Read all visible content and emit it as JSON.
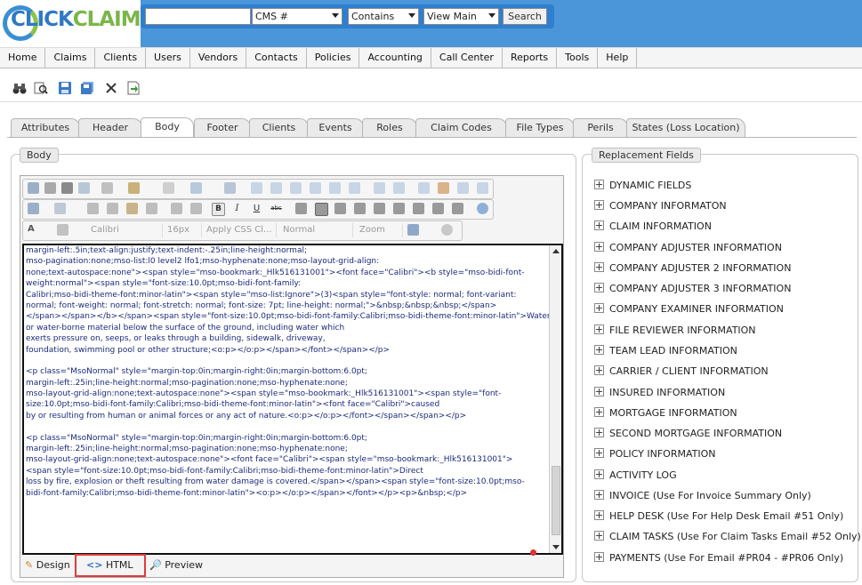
{
  "logo": {
    "left": "CLICK",
    "right": "CLAIMS"
  },
  "search": {
    "query_value": "",
    "field_select": "CMS #",
    "match_select": "Contains",
    "view_select": "View Main",
    "button": "Search"
  },
  "menu": [
    "Home",
    "Claims",
    "Clients",
    "Users",
    "Vendors",
    "Contacts",
    "Policies",
    "Accounting",
    "Call Center",
    "Reports",
    "Tools",
    "Help"
  ],
  "toolbar_icons": [
    "binoculars-icon",
    "find-icon",
    "save-icon",
    "save-all-icon",
    "close-icon",
    "export-icon"
  ],
  "tabs": [
    "Attributes",
    "Header",
    "Body",
    "Footer",
    "Clients",
    "Events",
    "Roles",
    "Claim Codes",
    "File Types",
    "Perils",
    "States (Loss Location)"
  ],
  "active_tab": "Body",
  "body_legend": "Body",
  "editor": {
    "font_name": "Calibri",
    "font_size": "16px",
    "css_class": "Apply CSS Cl...",
    "paragraph": "Normal",
    "zoom": "Zoom",
    "code_lines": [
      "margin-left:.5in;text-align:justify;text-indent:-.25in;line-height:normal;",
      "mso-pagination:none;mso-list:l0 level2 lfo1;mso-hyphenate:none;mso-layout-grid-align:",
      "none;text-autospace:none\"><span style=\"mso-bookmark:_Hlk516131001\"><font face=\"Calibri\"><b style=\"mso-bidi-font-",
      "weight:normal\"><span style=\"font-size:10.0pt;mso-bidi-font-family:",
      "Calibri;mso-bidi-theme-font:minor-latin\"><span style=\"mso-list:Ignore\">(3)<span style=\"font-style: normal; font-variant:",
      "normal; font-weight: normal; font-stretch: normal; font-size: 7pt; line-height: normal;\">&nbsp;&nbsp;&nbsp;</span>",
      "</span></span></b></span><span style=\"font-size:10.0pt;mso-bidi-font-family:Calibri;mso-bidi-theme-font:minor-latin\">Water",
      "or water-borne material below the surface of the ground, including water which",
      "exerts pressure on, seeps, or leaks through a building, sidewalk, driveway,",
      "foundation, swimming pool or other structure;<o:p></o:p></span></font></span></p>",
      "",
      "<p class=\"MsoNormal\" style=\"margin-top:0in;margin-right:0in;margin-bottom:6.0pt;",
      "margin-left:.25in;line-height:normal;mso-pagination:none;mso-hyphenate:none;",
      "mso-layout-grid-align:none;text-autospace:none\"><span style=\"mso-bookmark:_Hlk516131001\"><span style=\"font-",
      "size:10.0pt;mso-bidi-font-family:Calibri;mso-bidi-theme-font:minor-latin\"><font face=\"Calibri\">caused",
      "by or resulting from human or animal forces or any act of nature.<o:p></o:p></font></span></span></p>",
      "",
      "<p class=\"MsoNormal\" style=\"margin-top:0in;margin-right:0in;margin-bottom:6.0pt;",
      "margin-left:.25in;line-height:normal;mso-pagination:none;mso-hyphenate:none;",
      "mso-layout-grid-align:none;text-autospace:none\"><font face=\"Calibri\"><span style=\"mso-bookmark:_Hlk516131001\">",
      "<span style=\"font-size:10.0pt;mso-bidi-font-family:Calibri;mso-bidi-theme-font:minor-latin\">Direct",
      "loss by fire, explosion or theft resulting from water damage is covered.</span></span><span style=\"font-size:10.0pt;mso-",
      "bidi-font-family:Calibri;mso-bidi-theme-font:minor-latin\"><o:p></o:p></span></font></p><p>&nbsp;</p>"
    ],
    "modes": [
      "Design",
      "HTML",
      "Preview"
    ],
    "active_mode": "HTML"
  },
  "replacement_fields": {
    "title": "Replacement Fields",
    "items": [
      "DYNAMIC FIELDS",
      "COMPANY INFORMATON",
      "CLAIM INFORMATION",
      "COMPANY ADJUSTER INFORMATION",
      "COMPANY ADJUSTER 2 INFORMATION",
      "COMPANY ADJUSTER 3 INFORMATION",
      "COMPANY EXAMINER INFORMATION",
      "FILE REVIEWER INFORMATION",
      "TEAM LEAD INFORMATION",
      "CARRIER / CLIENT INFORMATION",
      "INSURED INFORMATION",
      "MORTGAGE INFORMATION",
      "SECOND MORTGAGE INFORMATION",
      "POLICY INFORMATION",
      "ACTIVITY LOG",
      "INVOICE (Use For Invoice Summary Only)",
      "HELP DESK (Use For Help Desk Email #51 Only)",
      "CLAIM TASKS (Use For Claim Tasks Email #52 Only)",
      "PAYMENTS (Use For Email #PR04 - #PR06 Only)"
    ]
  },
  "colors": {
    "topbar": "#4a96d8",
    "search_panel": "#2e7fd0",
    "logo_blue": "#2f78c4",
    "logo_green": "#7ab648",
    "highlight": "#e03a3a"
  }
}
